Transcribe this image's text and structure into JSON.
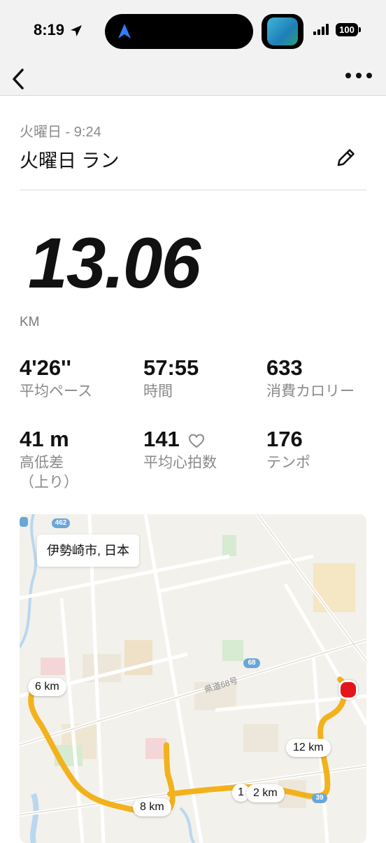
{
  "status_bar": {
    "time": "8:19",
    "battery": "100",
    "icons": [
      "location-arrow-icon",
      "navigation-icon",
      "app-icon",
      "signal-icon",
      "battery-icon"
    ]
  },
  "nav": {
    "icons": [
      "back-chevron-icon",
      "more-dots-icon"
    ]
  },
  "activity": {
    "date": "火曜日 - 9:24",
    "title": "火曜日 ラン",
    "distance": "13.06",
    "distance_unit": "KM"
  },
  "stats": [
    {
      "value": "4'26''",
      "label": "平均ペース"
    },
    {
      "value": "57:55",
      "label": "時間"
    },
    {
      "value": "633",
      "label": "消費カロリー"
    },
    {
      "value": "41 m",
      "label": "高低差",
      "label_sub": "（上り）"
    },
    {
      "value": "141",
      "label": "平均心拍数"
    },
    {
      "value": "176",
      "label": "テンポ"
    }
  ],
  "map": {
    "location": "伊勢崎市, 日本",
    "road_labels": [
      "462",
      "68",
      "39",
      "県道68号"
    ],
    "km_markers": [
      "6 km",
      "8 km",
      "1",
      "2 km",
      "12 km"
    ],
    "route_color": "#f2b21c",
    "end_marker_color": "#e6151c"
  }
}
